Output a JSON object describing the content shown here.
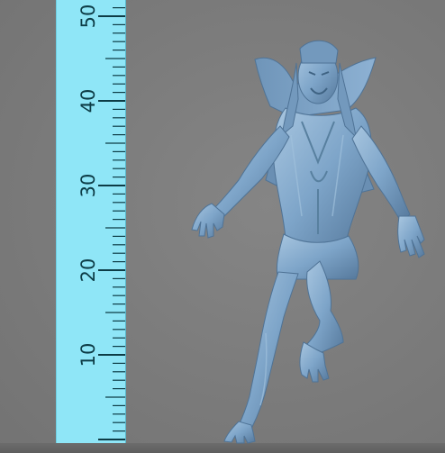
{
  "scene": {
    "background_color": "#7b7b7b",
    "model_color": "#7da4c8",
    "model_shadow_color": "#4f7396",
    "ruler_color": "#8fe6f7",
    "ruler_tick_color": "#0d3c46"
  },
  "ruler": {
    "unit_labels": [
      "10",
      "20",
      "30",
      "40",
      "50"
    ]
  }
}
